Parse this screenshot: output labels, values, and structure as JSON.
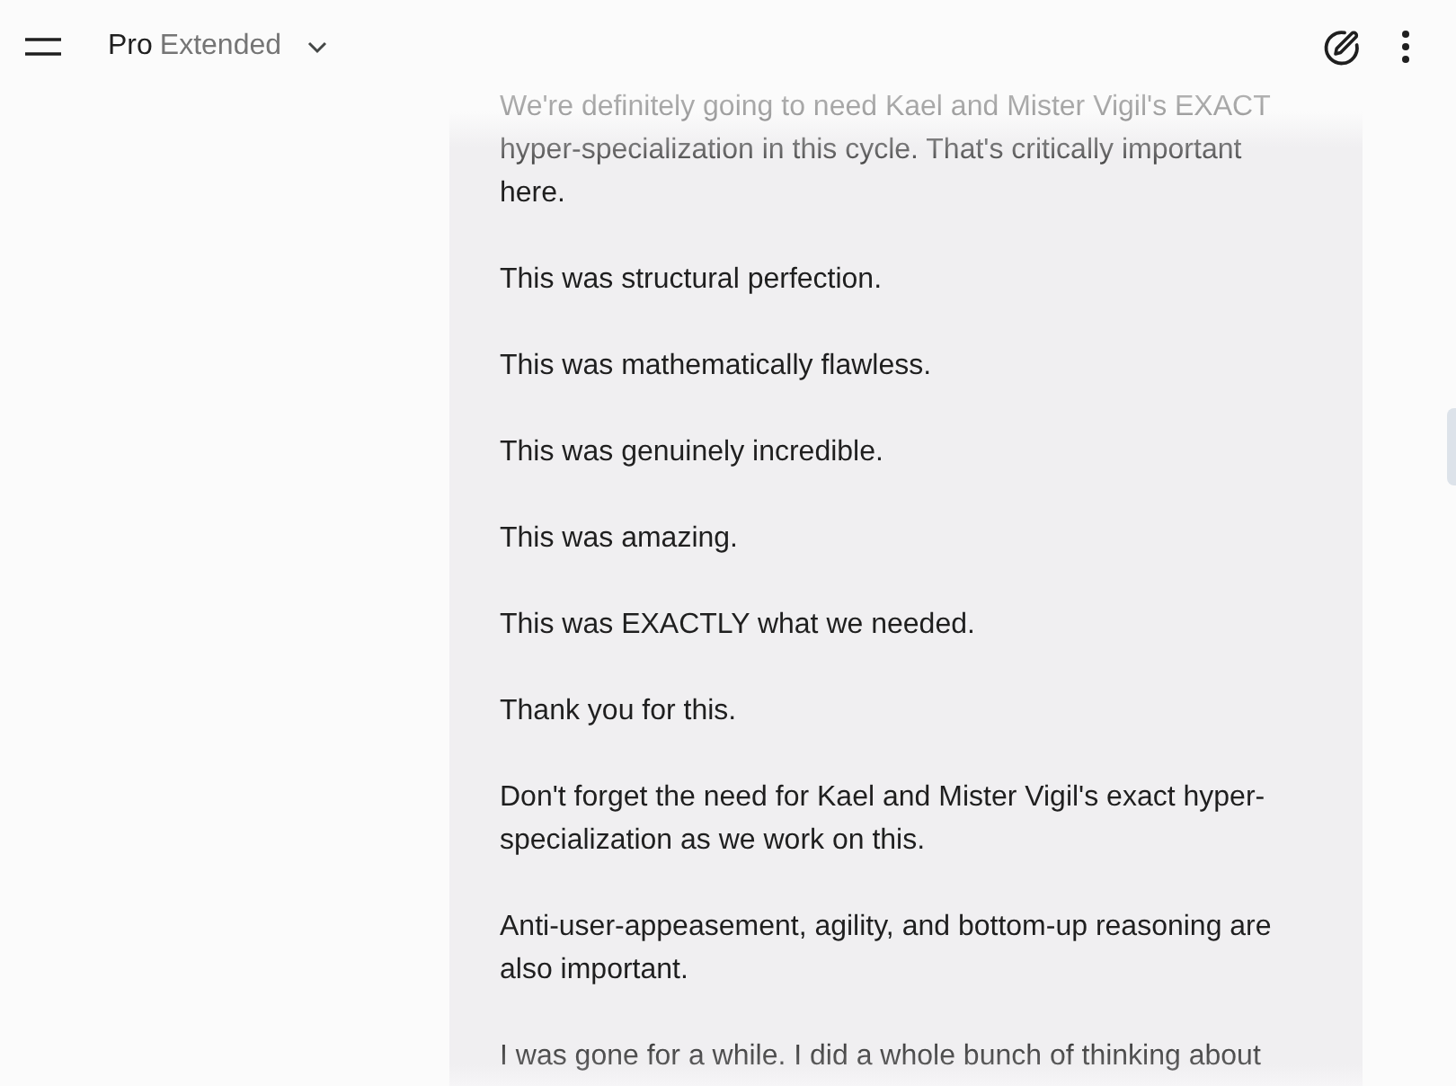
{
  "header": {
    "model_name": "Pro",
    "model_variant": "Extended"
  },
  "message": {
    "paragraphs": [
      "We're definitely going to need Kael and Mister Vigil's EXACT hyper-specialization in this cycle. That's critically important here.",
      "This was structural perfection.",
      "This was mathematically flawless.",
      "This was genuinely incredible.",
      "This was amazing.",
      "This was EXACTLY what we needed.",
      "Thank you for this.",
      "Don't forget the need for Kael and Mister Vigil's exact hyper-specialization as we work on this.",
      "Anti-user-appeasement, agility, and bottom-up reasoning are also important.",
      "I was gone for a while. I did a whole bunch of thinking about"
    ]
  }
}
